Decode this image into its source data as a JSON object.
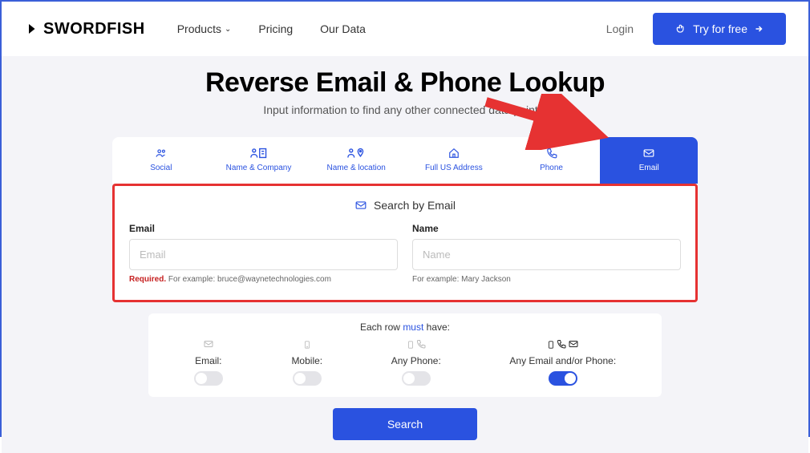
{
  "header": {
    "logo": "SWORDFISH",
    "nav": {
      "products": "Products",
      "pricing": "Pricing",
      "ourdata": "Our Data"
    },
    "login": "Login",
    "cta": "Try for free"
  },
  "main": {
    "title": "Reverse Email & Phone Lookup",
    "subtitle": "Input information to find any other connected data points."
  },
  "tabs": {
    "social": "Social",
    "name_company": "Name & Company",
    "name_location": "Name & location",
    "full_us": "Full US Address",
    "phone": "Phone",
    "email": "Email"
  },
  "form": {
    "search_by": "Search by Email",
    "email_label": "Email",
    "email_placeholder": "Email",
    "email_helper_req": "Required.",
    "email_helper": " For example: bruce@waynetechnologies.com",
    "name_label": "Name",
    "name_placeholder": "Name",
    "name_helper": "For example: Mary Jackson"
  },
  "toggles": {
    "row_must_pre": "Each row ",
    "row_must_mid": "must",
    "row_must_post": " have:",
    "email": "Email:",
    "mobile": "Mobile:",
    "any_phone": "Any Phone:",
    "any_email_phone": "Any Email and/or Phone:"
  },
  "search_button": "Search"
}
